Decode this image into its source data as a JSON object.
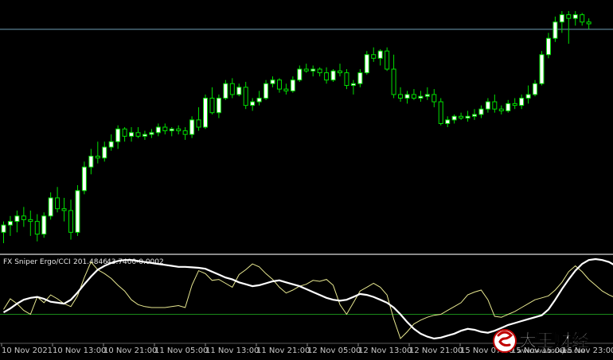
{
  "colors": {
    "background": "#000000",
    "bull_candle": "#ffffff",
    "wick": "#00e000",
    "bear_candle": "#000000",
    "price_level_line": "#6f9fb8",
    "panel_divider": "#b8b8b8",
    "ergo_line": "#ffffff",
    "cci_line": "#e8e890",
    "zero_line": "#1a8a1a",
    "time_text": "#c8c8c8"
  },
  "indicator": {
    "name": "FX Sniper Ergo/CCI",
    "value_1": "201.4846",
    "value_2": "43.7400",
    "value_3": "-0.0002"
  },
  "time_axis": {
    "labels": [
      "10 Nov 2021",
      "10 Nov 13:00",
      "10 Nov 21:00",
      "11 Nov 05:00",
      "11 Nov 13:00",
      "11 Nov 21:00",
      "12 Nov 05:00",
      "12 Nov 13:00",
      "12 Nov 21:00",
      "15 Nov 07:00",
      "15 Nov 15:00",
      "15 Nov 23:00"
    ]
  },
  "watermark": {
    "text": "大王财经",
    "subtext": "WWW.DAWANGCAIJING.COM",
    "icon": "wang-logo-icon"
  },
  "chart_data": [
    {
      "type": "candlestick",
      "title": "",
      "note": "price axis values are not shown in the screenshot; values are relative (0 = lowest, 100 = highest)",
      "candles": [
        {
          "o": 6,
          "h": 12,
          "l": 0,
          "c": 10
        },
        {
          "o": 10,
          "h": 15,
          "l": 4,
          "c": 12
        },
        {
          "o": 12,
          "h": 18,
          "l": 6,
          "c": 15
        },
        {
          "o": 15,
          "h": 20,
          "l": 9,
          "c": 13
        },
        {
          "o": 13,
          "h": 18,
          "l": 4,
          "c": 12
        },
        {
          "o": 12,
          "h": 16,
          "l": 1,
          "c": 5
        },
        {
          "o": 5,
          "h": 17,
          "l": 3,
          "c": 15
        },
        {
          "o": 15,
          "h": 28,
          "l": 13,
          "c": 25
        },
        {
          "o": 25,
          "h": 31,
          "l": 17,
          "c": 19
        },
        {
          "o": 19,
          "h": 25,
          "l": 12,
          "c": 18
        },
        {
          "o": 18,
          "h": 24,
          "l": 2,
          "c": 6
        },
        {
          "o": 6,
          "h": 32,
          "l": 4,
          "c": 29
        },
        {
          "o": 29,
          "h": 45,
          "l": 27,
          "c": 42
        },
        {
          "o": 42,
          "h": 52,
          "l": 38,
          "c": 48
        },
        {
          "o": 48,
          "h": 56,
          "l": 44,
          "c": 47
        },
        {
          "o": 47,
          "h": 56,
          "l": 45,
          "c": 53
        },
        {
          "o": 53,
          "h": 60,
          "l": 51,
          "c": 56
        },
        {
          "o": 56,
          "h": 65,
          "l": 52,
          "c": 63
        },
        {
          "o": 63,
          "h": 64,
          "l": 56,
          "c": 59
        },
        {
          "o": 59,
          "h": 64,
          "l": 56,
          "c": 61
        },
        {
          "o": 61,
          "h": 64,
          "l": 58,
          "c": 59
        },
        {
          "o": 59,
          "h": 62,
          "l": 57,
          "c": 60
        },
        {
          "o": 60,
          "h": 63,
          "l": 58,
          "c": 61
        },
        {
          "o": 61,
          "h": 66,
          "l": 59,
          "c": 64
        },
        {
          "o": 64,
          "h": 66,
          "l": 60,
          "c": 62
        },
        {
          "o": 62,
          "h": 64,
          "l": 59,
          "c": 63
        },
        {
          "o": 63,
          "h": 65,
          "l": 60,
          "c": 62
        },
        {
          "o": 62,
          "h": 64,
          "l": 57,
          "c": 60
        },
        {
          "o": 60,
          "h": 70,
          "l": 58,
          "c": 68
        },
        {
          "o": 68,
          "h": 75,
          "l": 62,
          "c": 64
        },
        {
          "o": 64,
          "h": 82,
          "l": 63,
          "c": 80
        },
        {
          "o": 80,
          "h": 86,
          "l": 71,
          "c": 72
        },
        {
          "o": 72,
          "h": 82,
          "l": 69,
          "c": 80
        },
        {
          "o": 80,
          "h": 90,
          "l": 79,
          "c": 88
        },
        {
          "o": 88,
          "h": 91,
          "l": 80,
          "c": 82
        },
        {
          "o": 82,
          "h": 88,
          "l": 81,
          "c": 86
        },
        {
          "o": 86,
          "h": 89,
          "l": 74,
          "c": 76
        },
        {
          "o": 76,
          "h": 80,
          "l": 73,
          "c": 78
        },
        {
          "o": 78,
          "h": 84,
          "l": 76,
          "c": 80
        },
        {
          "o": 80,
          "h": 90,
          "l": 79,
          "c": 88
        },
        {
          "o": 88,
          "h": 92,
          "l": 86,
          "c": 90
        },
        {
          "o": 90,
          "h": 91,
          "l": 83,
          "c": 85
        },
        {
          "o": 85,
          "h": 88,
          "l": 82,
          "c": 84
        },
        {
          "o": 84,
          "h": 92,
          "l": 83,
          "c": 90
        },
        {
          "o": 90,
          "h": 98,
          "l": 89,
          "c": 96
        },
        {
          "o": 96,
          "h": 99,
          "l": 94,
          "c": 95
        },
        {
          "o": 95,
          "h": 98,
          "l": 92,
          "c": 96
        },
        {
          "o": 96,
          "h": 97,
          "l": 92,
          "c": 94
        },
        {
          "o": 94,
          "h": 97,
          "l": 88,
          "c": 90
        },
        {
          "o": 90,
          "h": 96,
          "l": 89,
          "c": 95
        },
        {
          "o": 95,
          "h": 99,
          "l": 92,
          "c": 94
        },
        {
          "o": 94,
          "h": 96,
          "l": 85,
          "c": 87
        },
        {
          "o": 87,
          "h": 90,
          "l": 82,
          "c": 88
        },
        {
          "o": 88,
          "h": 96,
          "l": 86,
          "c": 94
        },
        {
          "o": 94,
          "h": 106,
          "l": 93,
          "c": 104
        },
        {
          "o": 104,
          "h": 108,
          "l": 100,
          "c": 102
        },
        {
          "o": 102,
          "h": 107,
          "l": 98,
          "c": 106
        },
        {
          "o": 106,
          "h": 108,
          "l": 95,
          "c": 96
        },
        {
          "o": 96,
          "h": 104,
          "l": 80,
          "c": 82
        },
        {
          "o": 82,
          "h": 86,
          "l": 78,
          "c": 80
        },
        {
          "o": 80,
          "h": 84,
          "l": 77,
          "c": 82
        },
        {
          "o": 82,
          "h": 85,
          "l": 79,
          "c": 80
        },
        {
          "o": 80,
          "h": 84,
          "l": 78,
          "c": 81
        },
        {
          "o": 81,
          "h": 86,
          "l": 79,
          "c": 82
        },
        {
          "o": 82,
          "h": 85,
          "l": 75,
          "c": 78
        },
        {
          "o": 78,
          "h": 80,
          "l": 65,
          "c": 66
        },
        {
          "o": 66,
          "h": 70,
          "l": 64,
          "c": 68
        },
        {
          "o": 68,
          "h": 71,
          "l": 66,
          "c": 70
        },
        {
          "o": 70,
          "h": 72,
          "l": 68,
          "c": 69
        },
        {
          "o": 69,
          "h": 73,
          "l": 67,
          "c": 70
        },
        {
          "o": 70,
          "h": 74,
          "l": 68,
          "c": 71
        },
        {
          "o": 71,
          "h": 76,
          "l": 69,
          "c": 74
        },
        {
          "o": 74,
          "h": 80,
          "l": 72,
          "c": 78
        },
        {
          "o": 78,
          "h": 82,
          "l": 72,
          "c": 74
        },
        {
          "o": 74,
          "h": 76,
          "l": 71,
          "c": 73
        },
        {
          "o": 73,
          "h": 79,
          "l": 72,
          "c": 77
        },
        {
          "o": 77,
          "h": 80,
          "l": 74,
          "c": 76
        },
        {
          "o": 76,
          "h": 82,
          "l": 74,
          "c": 80
        },
        {
          "o": 80,
          "h": 87,
          "l": 77,
          "c": 82
        },
        {
          "o": 82,
          "h": 90,
          "l": 81,
          "c": 88
        },
        {
          "o": 88,
          "h": 106,
          "l": 87,
          "c": 104
        },
        {
          "o": 104,
          "h": 116,
          "l": 102,
          "c": 113
        },
        {
          "o": 113,
          "h": 125,
          "l": 111,
          "c": 122
        },
        {
          "o": 122,
          "h": 128,
          "l": 116,
          "c": 126
        },
        {
          "o": 126,
          "h": 128,
          "l": 110,
          "c": 124
        },
        {
          "o": 124,
          "h": 128,
          "l": 120,
          "c": 126
        },
        {
          "o": 126,
          "h": 127,
          "l": 120,
          "c": 122
        },
        {
          "o": 122,
          "h": 124,
          "l": 118,
          "c": 121
        }
      ],
      "price_level": 118
    },
    {
      "type": "line",
      "title": "FX Sniper Ergo/CCI",
      "note": "oscillator; zero line marked; values relative",
      "series": [
        {
          "name": "",
          "color": "#ffffff",
          "values": [
            4,
            12,
            22,
            30,
            34,
            36,
            32,
            26,
            24,
            22,
            30,
            45,
            62,
            78,
            92,
            100,
            106,
            110,
            112,
            112,
            110,
            108,
            106,
            104,
            102,
            100,
            98,
            98,
            97,
            96,
            94,
            88,
            82,
            76,
            72,
            66,
            62,
            58,
            60,
            64,
            68,
            70,
            66,
            62,
            58,
            52,
            46,
            40,
            34,
            30,
            28,
            30,
            36,
            42,
            40,
            36,
            30,
            24,
            14,
            0,
            -16,
            -30,
            -40,
            -46,
            -50,
            -48,
            -44,
            -40,
            -34,
            -30,
            -32,
            -36,
            -38,
            -34,
            -28,
            -22,
            -18,
            -14,
            -10,
            -6,
            -2,
            10,
            30,
            52,
            72,
            90,
            104,
            112,
            114,
            112,
            108,
            100,
            92
          ]
        },
        {
          "name": "",
          "color": "#e8e890",
          "values": [
            10,
            32,
            22,
            8,
            0,
            36,
            24,
            40,
            32,
            22,
            16,
            38,
            76,
            108,
            92,
            84,
            74,
            60,
            48,
            30,
            20,
            16,
            14,
            14,
            14,
            16,
            18,
            14,
            60,
            90,
            84,
            70,
            72,
            64,
            56,
            82,
            92,
            104,
            98,
            84,
            72,
            56,
            44,
            50,
            58,
            62,
            70,
            68,
            72,
            60,
            20,
            0,
            24,
            48,
            56,
            64,
            56,
            40,
            -10,
            -50,
            -36,
            -20,
            -12,
            -6,
            -2,
            0,
            8,
            16,
            24,
            40,
            46,
            50,
            30,
            -4,
            -6,
            0,
            6,
            14,
            22,
            30,
            34,
            38,
            50,
            66,
            88,
            100,
            88,
            72,
            60,
            48,
            40,
            34,
            30
          ]
        }
      ]
    }
  ]
}
